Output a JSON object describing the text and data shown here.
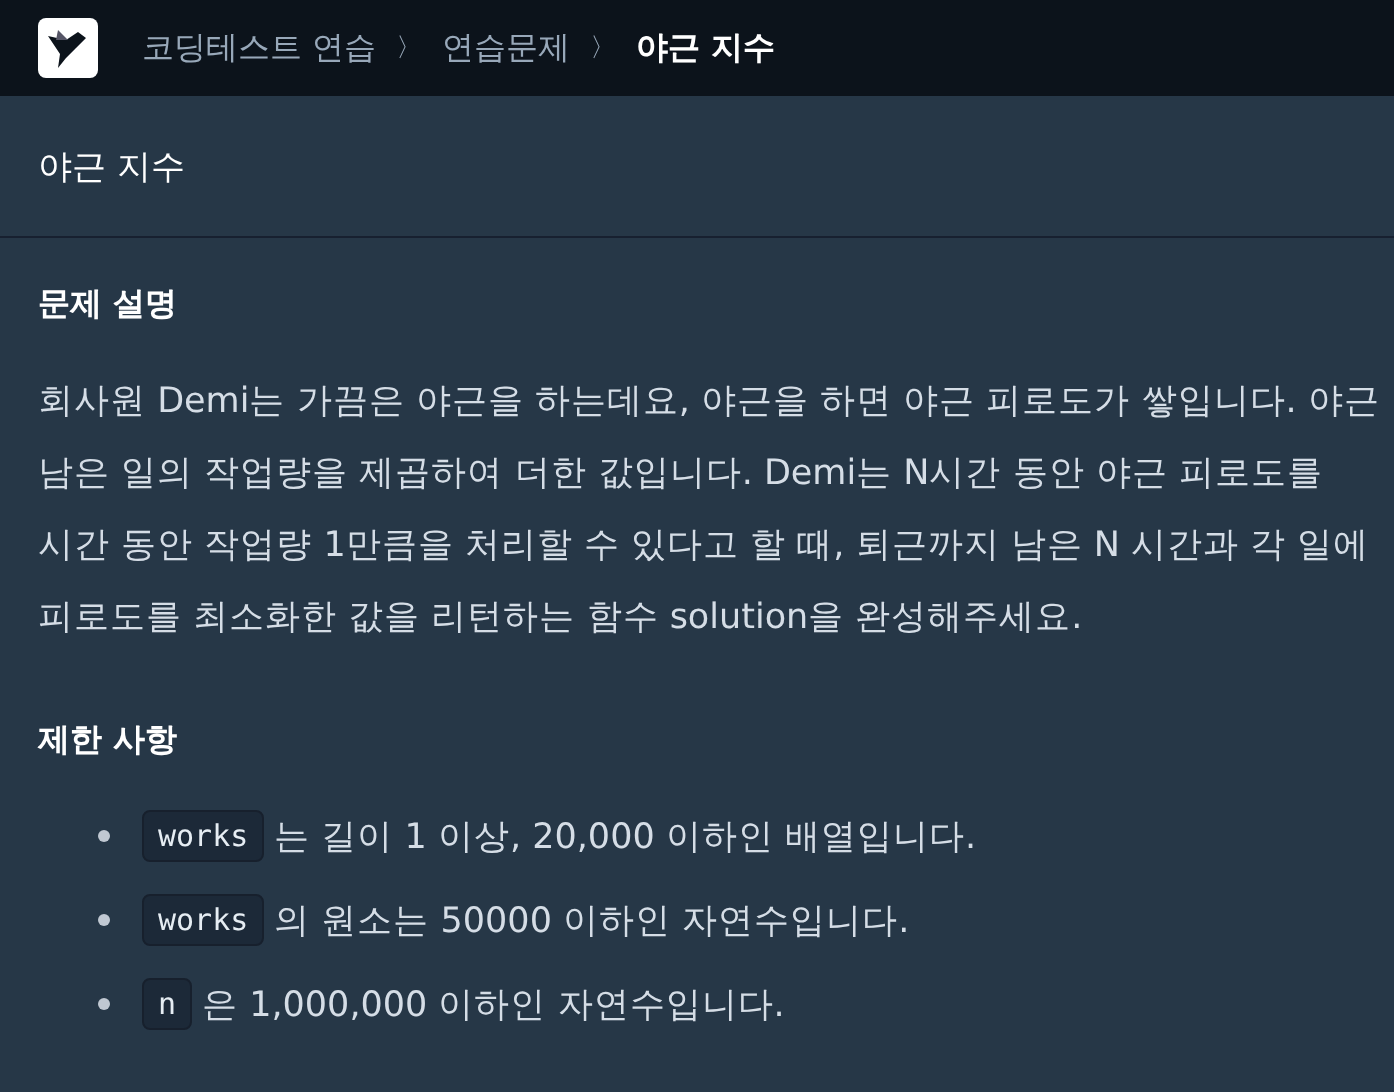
{
  "breadcrumb": [
    {
      "label": "코딩테스트 연습",
      "current": false
    },
    {
      "label": "연습문제",
      "current": false
    },
    {
      "label": "야근 지수",
      "current": true
    }
  ],
  "separator": "〉",
  "title": "야근 지수",
  "sections": [
    {
      "heading": "문제 설명",
      "kind": "paragraph",
      "lines": [
        "회사원 Demi는 가끔은 야근을 하는데요, 야근을 하면 야근 피로도가 쌓입니다. 야근",
        "남은 일의 작업량을 제곱하여 더한 값입니다. Demi는 N시간 동안 야근 피로도를",
        "시간 동안 작업량 1만큼을 처리할 수 있다고 할 때, 퇴근까지 남은 N 시간과 각 일에",
        "피로도를 최소화한 값을 리턴하는 함수 solution을 완성해주세요."
      ]
    },
    {
      "heading": "제한 사항",
      "kind": "list",
      "items": [
        {
          "code": "works",
          "text": "는 길이 1 이상, 20,000 이하인 배열입니다."
        },
        {
          "code": "works",
          "text": "의 원소는 50000 이하인 자연수입니다."
        },
        {
          "code": "n",
          "text": "은 1,000,000 이하인 자연수입니다."
        }
      ]
    }
  ]
}
